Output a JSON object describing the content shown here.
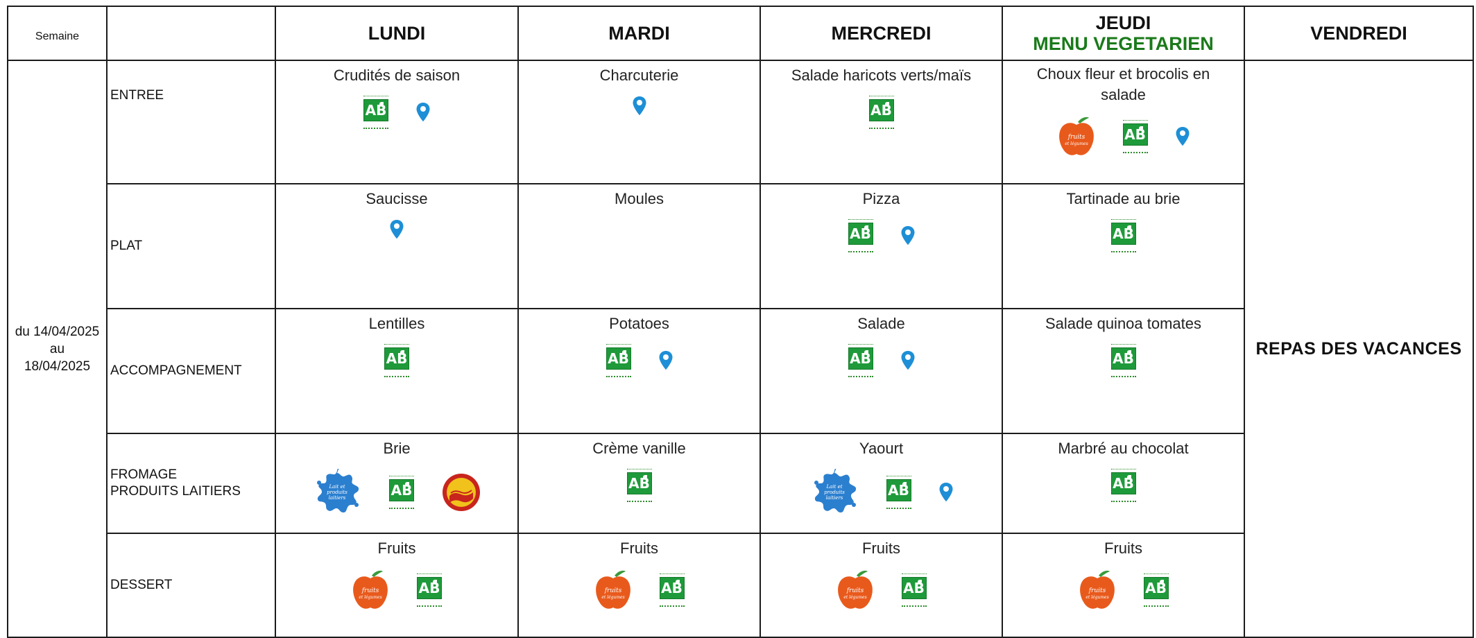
{
  "header": {
    "semaine_label": "Semaine",
    "days": [
      "LUNDI",
      "MARDI",
      "MERCREDI",
      "JEUDI",
      "VENDREDI"
    ],
    "jeudi_sub": "MENU VEGETARIEN"
  },
  "week": {
    "line1": "du 14/04/2025",
    "line2": "au",
    "line3": "18/04/2025"
  },
  "categories": [
    "ENTREE",
    "PLAT",
    "ACCOMPAGNEMENT",
    "FROMAGE",
    "PRODUITS LAITIERS",
    "DESSERT"
  ],
  "vendredi": "REPAS DES VACANCES",
  "rows": [
    {
      "cells": [
        {
          "name": "Crudités de saison",
          "badges": [
            "ab-logo",
            "location-pin"
          ]
        },
        {
          "name": "Charcuterie",
          "badges": [
            "location-pin"
          ]
        },
        {
          "name": "Salade haricots verts/maïs",
          "badges": [
            "ab-logo"
          ]
        },
        {
          "name": "Choux fleur et brocolis en salade",
          "badges": [
            "fruits-legumes-ecole-logo",
            "ab-logo",
            "location-pin"
          ]
        }
      ]
    },
    {
      "cells": [
        {
          "name": "Saucisse",
          "badges": [
            "location-pin"
          ]
        },
        {
          "name": "Moules",
          "badges": []
        },
        {
          "name": "Pizza",
          "badges": [
            "ab-logo",
            "location-pin"
          ]
        },
        {
          "name": "Tartinade au brie",
          "badges": [
            "ab-logo"
          ]
        }
      ]
    },
    {
      "cells": [
        {
          "name": "Lentilles",
          "badges": [
            "ab-logo"
          ]
        },
        {
          "name": "Potatoes",
          "badges": [
            "ab-logo",
            "location-pin"
          ]
        },
        {
          "name": "Salade",
          "badges": [
            "ab-logo",
            "location-pin"
          ]
        },
        {
          "name": "Salade quinoa tomates",
          "badges": [
            "ab-logo"
          ]
        }
      ]
    },
    {
      "cells": [
        {
          "name": "Brie",
          "badges": [
            "lait-produits-laitiers-logo",
            "ab-logo",
            "aop-seal"
          ]
        },
        {
          "name": "Crème vanille",
          "badges": [
            "ab-logo"
          ]
        },
        {
          "name": "Yaourt",
          "badges": [
            "lait-produits-laitiers-logo",
            "ab-logo",
            "location-pin"
          ]
        },
        {
          "name": "Marbré au chocolat",
          "badges": [
            "ab-logo"
          ]
        }
      ]
    },
    {
      "cells": [
        {
          "name": "Fruits",
          "badges": [
            "fruits-legumes-ecole-logo",
            "ab-logo"
          ]
        },
        {
          "name": "Fruits",
          "badges": [
            "fruits-legumes-ecole-logo",
            "ab-logo"
          ]
        },
        {
          "name": "Fruits",
          "badges": [
            "fruits-legumes-ecole-logo",
            "ab-logo"
          ]
        },
        {
          "name": "Fruits",
          "badges": [
            "fruits-legumes-ecole-logo",
            "ab-logo"
          ]
        }
      ]
    }
  ],
  "colors": {
    "ab_green": "#1e9a3a",
    "pin_blue": "#1e8fd6",
    "veg_green": "#1a7a1a",
    "apple_orange": "#e85a1c",
    "milk_blue": "#2b7fcf"
  }
}
